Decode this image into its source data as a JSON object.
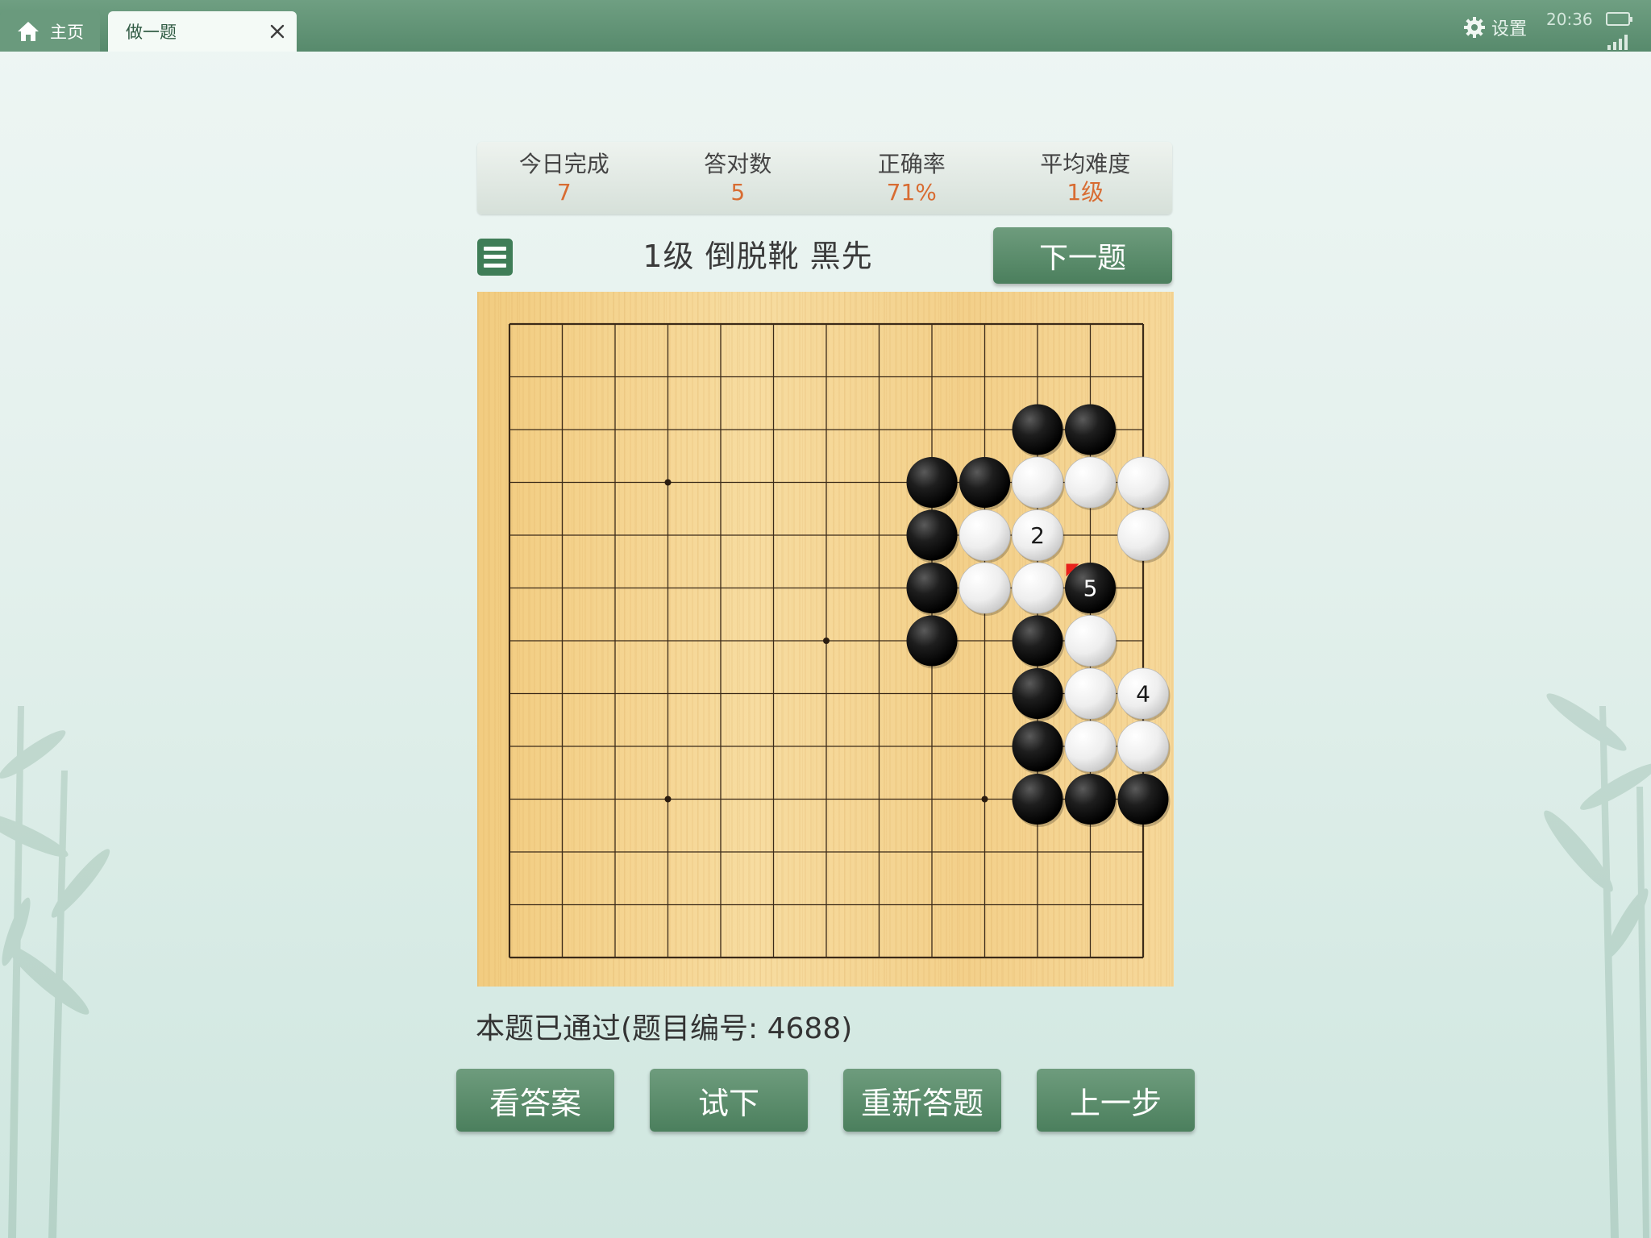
{
  "tabs": {
    "home_label": "主页",
    "current_label": "做一题"
  },
  "status_bar": {
    "settings_label": "设置",
    "time": "20:36"
  },
  "stats": [
    {
      "label": "今日完成",
      "value": "7"
    },
    {
      "label": "答对数",
      "value": "5"
    },
    {
      "label": "正确率",
      "value": "71%"
    },
    {
      "label": "平均难度",
      "value": "1级"
    }
  ],
  "problem": {
    "title": "1级 倒脱靴 黑先",
    "next_label": "下一题",
    "status": "本题已通过(题目编号: 4688)"
  },
  "actions": {
    "answer_label": "看答案",
    "try_label": "试下",
    "retry_label": "重新答题",
    "prev_label": "上一步"
  },
  "board": {
    "size": 13,
    "star_points": [
      [
        3,
        3
      ],
      [
        9,
        3
      ],
      [
        6,
        6
      ],
      [
        3,
        9
      ],
      [
        9,
        9
      ]
    ],
    "stones": [
      {
        "c": "b",
        "x": 10,
        "y": 2
      },
      {
        "c": "b",
        "x": 11,
        "y": 2
      },
      {
        "c": "b",
        "x": 8,
        "y": 3
      },
      {
        "c": "b",
        "x": 9,
        "y": 3
      },
      {
        "c": "w",
        "x": 10,
        "y": 3
      },
      {
        "c": "w",
        "x": 11,
        "y": 3
      },
      {
        "c": "w",
        "x": 12,
        "y": 3
      },
      {
        "c": "b",
        "x": 8,
        "y": 4
      },
      {
        "c": "w",
        "x": 9,
        "y": 4
      },
      {
        "c": "w",
        "x": 10,
        "y": 4,
        "n": "2"
      },
      {
        "c": "w",
        "x": 12,
        "y": 4
      },
      {
        "c": "b",
        "x": 8,
        "y": 5
      },
      {
        "c": "w",
        "x": 9,
        "y": 5
      },
      {
        "c": "w",
        "x": 10,
        "y": 5
      },
      {
        "c": "b",
        "x": 11,
        "y": 5,
        "n": "5"
      },
      {
        "c": "b",
        "x": 8,
        "y": 6
      },
      {
        "c": "b",
        "x": 10,
        "y": 6
      },
      {
        "c": "w",
        "x": 11,
        "y": 6
      },
      {
        "c": "b",
        "x": 10,
        "y": 7
      },
      {
        "c": "w",
        "x": 11,
        "y": 7
      },
      {
        "c": "w",
        "x": 12,
        "y": 7,
        "n": "4"
      },
      {
        "c": "b",
        "x": 10,
        "y": 8
      },
      {
        "c": "w",
        "x": 11,
        "y": 8
      },
      {
        "c": "w",
        "x": 12,
        "y": 8
      },
      {
        "c": "b",
        "x": 10,
        "y": 9
      },
      {
        "c": "b",
        "x": 11,
        "y": 9
      },
      {
        "c": "b",
        "x": 12,
        "y": 9
      }
    ],
    "last_move_marker": {
      "x": 11,
      "y": 5
    },
    "marker_color": "#e8231c"
  },
  "colors": {
    "accent_green": "#4b7f5d",
    "stat_value": "#d86c32"
  }
}
